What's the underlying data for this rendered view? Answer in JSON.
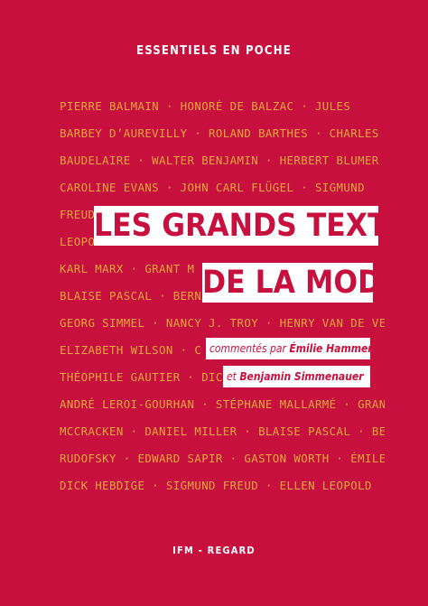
{
  "book": {
    "series": "ESSENTIELS EN POCHE",
    "title_line_1": "LES GRANDS TEXTES",
    "title_line_2": "DE LA MODE",
    "credits_line_1_prefix": "commentés par ",
    "credits_line_1_name": "Émilie Hammen",
    "credits_line_2_prefix": "et ",
    "credits_line_2_name": "Benjamin Simmenauer",
    "publisher": "IFM - REGARD"
  },
  "authors_lines": [
    "PIERRE BALMAIN · HONORÉ DE BALZAC · JULES",
    "BARBEY D’AUREVILLY · ROLAND BARTHES · CHARLES",
    "BAUDELAIRE · WALTER BENJAMIN · HERBERT BLUMER",
    "CAROLINE EVANS · JOHN CARL FLÜGEL · SIGMUND",
    "FREUD",
    "LEOPO",
    "KARL MARX · GRANT M",
    "BLAISE PASCAL · BERNAR",
    "GEORG SIMMEL · NANCY J. TROY · HENRY VAN DE VELDE",
    "ELIZABETH WILSON · C",
    "THÉOPHILE GAUTIER · DICK H",
    "ANDRÉ LEROI-GOURHAN · STÉPHANE MALLARMÉ · GRANT",
    "MCCRACKEN · DANIEL MILLER · BLAISE PASCAL · BERNARD",
    "RUDOFSKY · EDWARD SAPIR · GASTON WORTH · ÉMILE ZOLA",
    "DICK HEBDIGE · SIGMUND FREUD · ELLEN LEOPOLD"
  ],
  "colors": {
    "background": "#c8103f",
    "author_text": "#e6a83a",
    "title_box": "#ffffff",
    "title_text": "#c8103f"
  }
}
